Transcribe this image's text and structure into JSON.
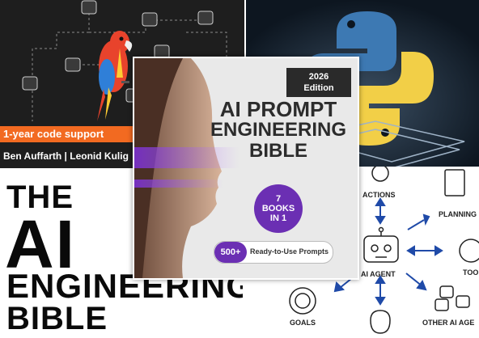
{
  "covers": {
    "top_left": {
      "band_text": "1-year code support",
      "authors": "Ben Auffarth | Leonid Kulig",
      "accent_color": "#f26a21"
    },
    "top_right": {
      "logo": "python-logo-icon"
    },
    "bottom_left": {
      "title_line_1": "THE",
      "title_line_2": "AI",
      "title_line_3": "ENGINEERING",
      "title_line_4": "BIBLE"
    },
    "center": {
      "edition": "2026\nEdition",
      "title_line_1": "AI PROMPT",
      "title_line_2": "ENGINEERING",
      "title_line_3": "BIBLE",
      "seal": "7\nBOOKS\nIN 1",
      "pill_number": "500+",
      "pill_text": "Ready-to-Use Prompts",
      "accent_color": "#6b2fb3"
    },
    "bottom_right": {
      "center_label": "AI AGENT",
      "labels": {
        "actions": "ACTIONS",
        "planning": "PLANNING",
        "tools": "TOO",
        "goals": "GOALS",
        "other_agents": "OTHER AI AGE"
      }
    }
  }
}
